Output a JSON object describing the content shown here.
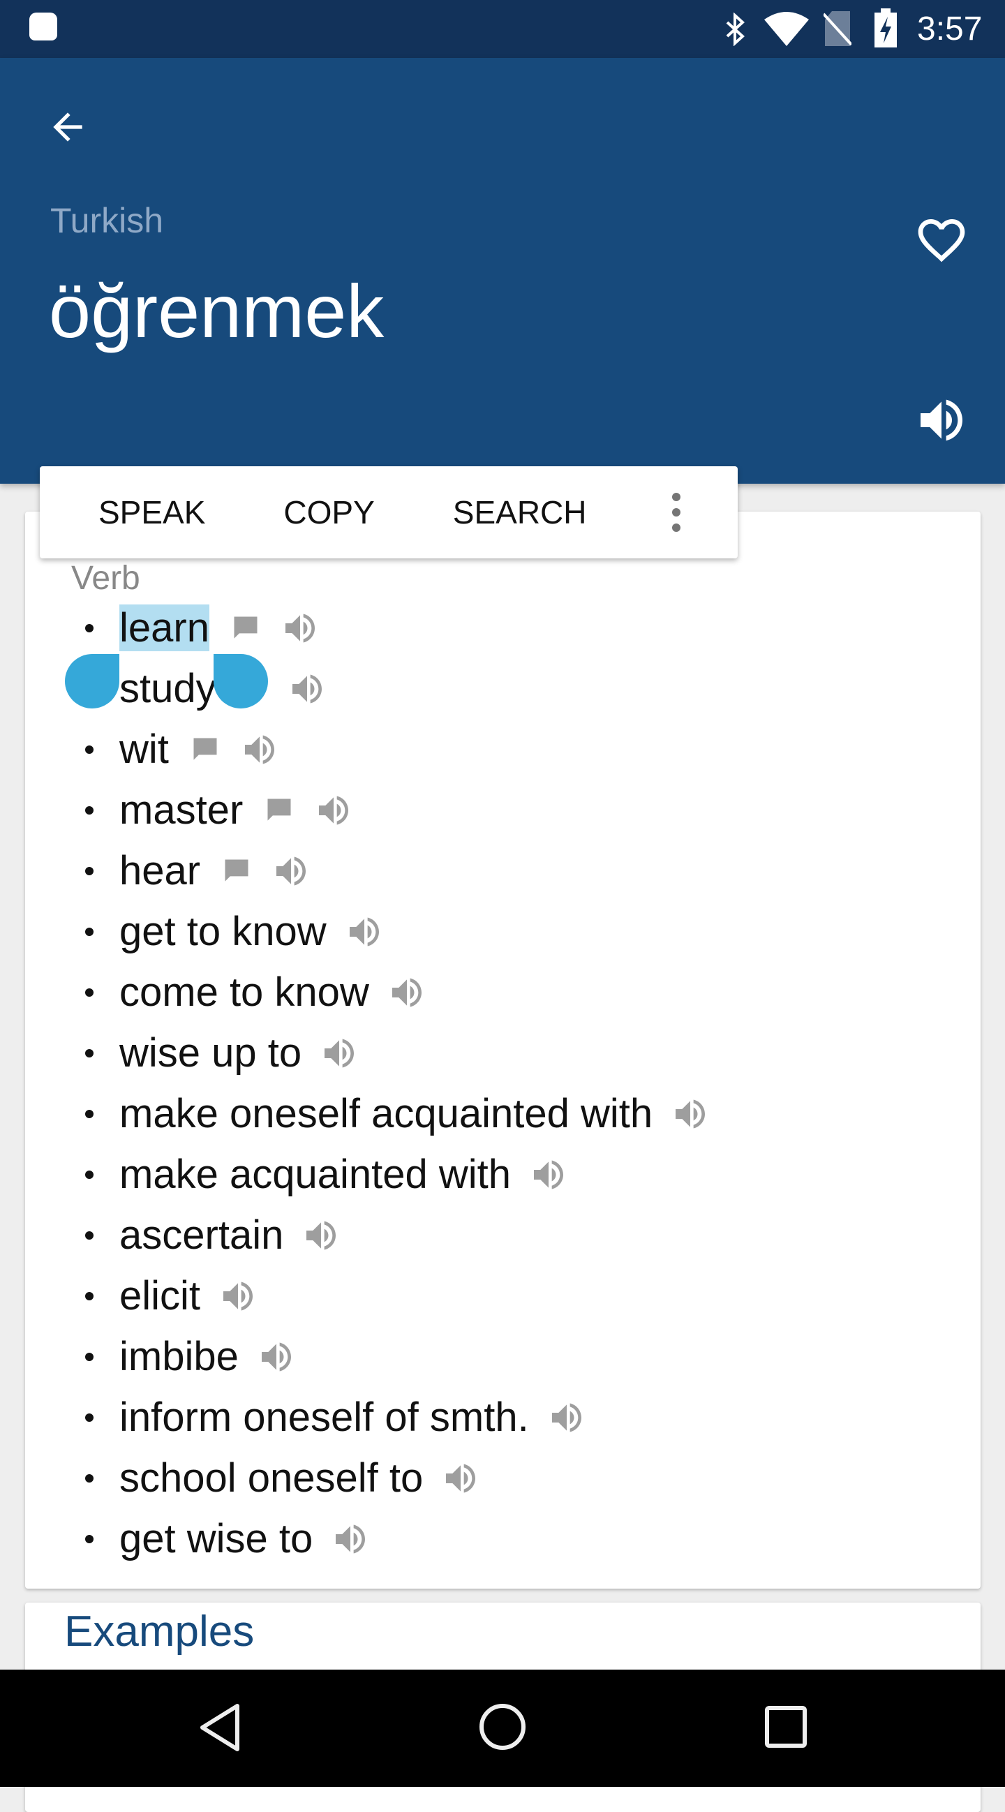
{
  "status_bar": {
    "time": "3:57",
    "icons": [
      "android-icon",
      "bluetooth-icon",
      "wifi-icon",
      "no-sim-icon",
      "battery-charging-icon"
    ]
  },
  "header": {
    "language": "Turkish",
    "word": "öğrenmek",
    "accent": "#174a7c"
  },
  "popup": {
    "speak": "SPEAK",
    "copy": "COPY",
    "search": "SEARCH"
  },
  "card": {
    "section": "Verb",
    "items": [
      {
        "text": "learn",
        "chat": true
      },
      {
        "text": "study",
        "chat": true
      },
      {
        "text": "wit",
        "chat": true
      },
      {
        "text": "master",
        "chat": true
      },
      {
        "text": "hear",
        "chat": true
      },
      {
        "text": "get to know"
      },
      {
        "text": "come to know"
      },
      {
        "text": "wise up to"
      },
      {
        "text": "make oneself acquainted with"
      },
      {
        "text": "make acquainted with"
      },
      {
        "text": "ascertain"
      },
      {
        "text": "elicit"
      },
      {
        "text": "imbibe"
      },
      {
        "text": "inform oneself of smth."
      },
      {
        "text": "school oneself to"
      },
      {
        "text": "get wise to"
      }
    ]
  },
  "examples": {
    "title": "Examples"
  }
}
